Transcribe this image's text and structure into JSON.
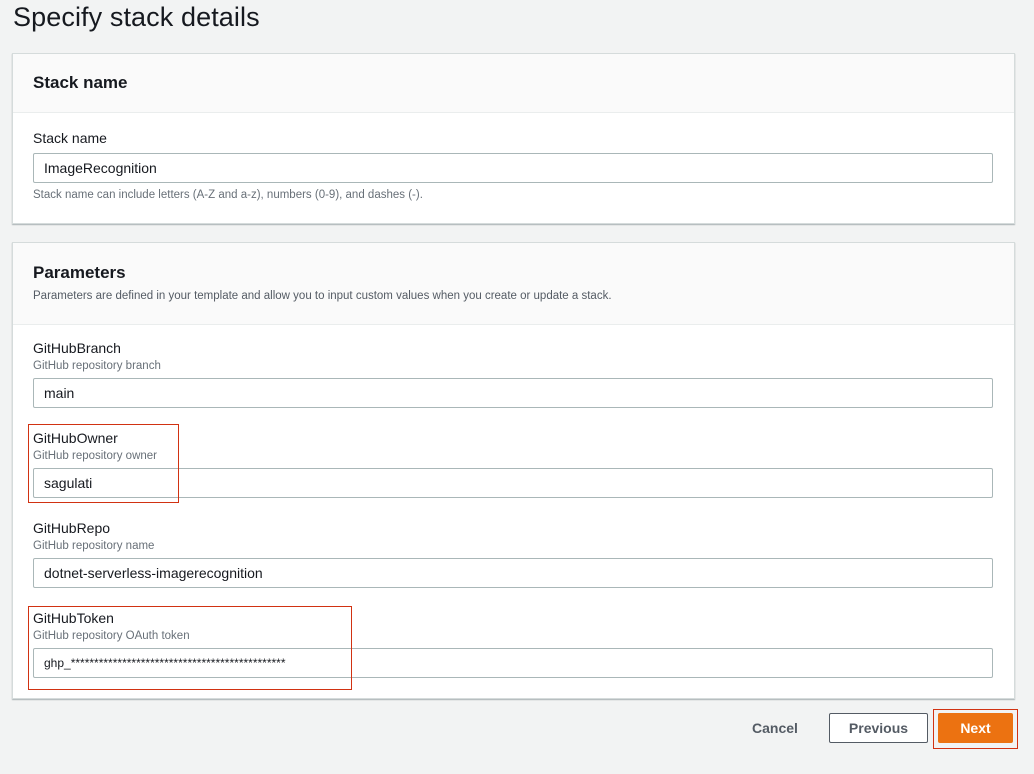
{
  "page": {
    "title": "Specify stack details"
  },
  "stack_name_section": {
    "title": "Stack name",
    "field_label": "Stack name",
    "value": "ImageRecognition",
    "hint": "Stack name can include letters (A-Z and a-z), numbers (0-9), and dashes (-)."
  },
  "parameters_section": {
    "title": "Parameters",
    "description": "Parameters are defined in your template and allow you to input custom values when you create or update a stack.",
    "params": [
      {
        "label": "GitHubBranch",
        "description": "GitHub repository branch",
        "value": "main"
      },
      {
        "label": "GitHubOwner",
        "description": "GitHub repository owner",
        "value": "sagulati"
      },
      {
        "label": "GitHubRepo",
        "description": "GitHub repository name",
        "value": "dotnet-serverless-imagerecognition"
      },
      {
        "label": "GitHubToken",
        "description": "GitHub repository OAuth token",
        "value": "ghp_**********************************************"
      }
    ]
  },
  "actions": {
    "cancel": "Cancel",
    "previous": "Previous",
    "next": "Next"
  },
  "colors": {
    "primary": "#ec7211",
    "highlight": "#d13212"
  }
}
